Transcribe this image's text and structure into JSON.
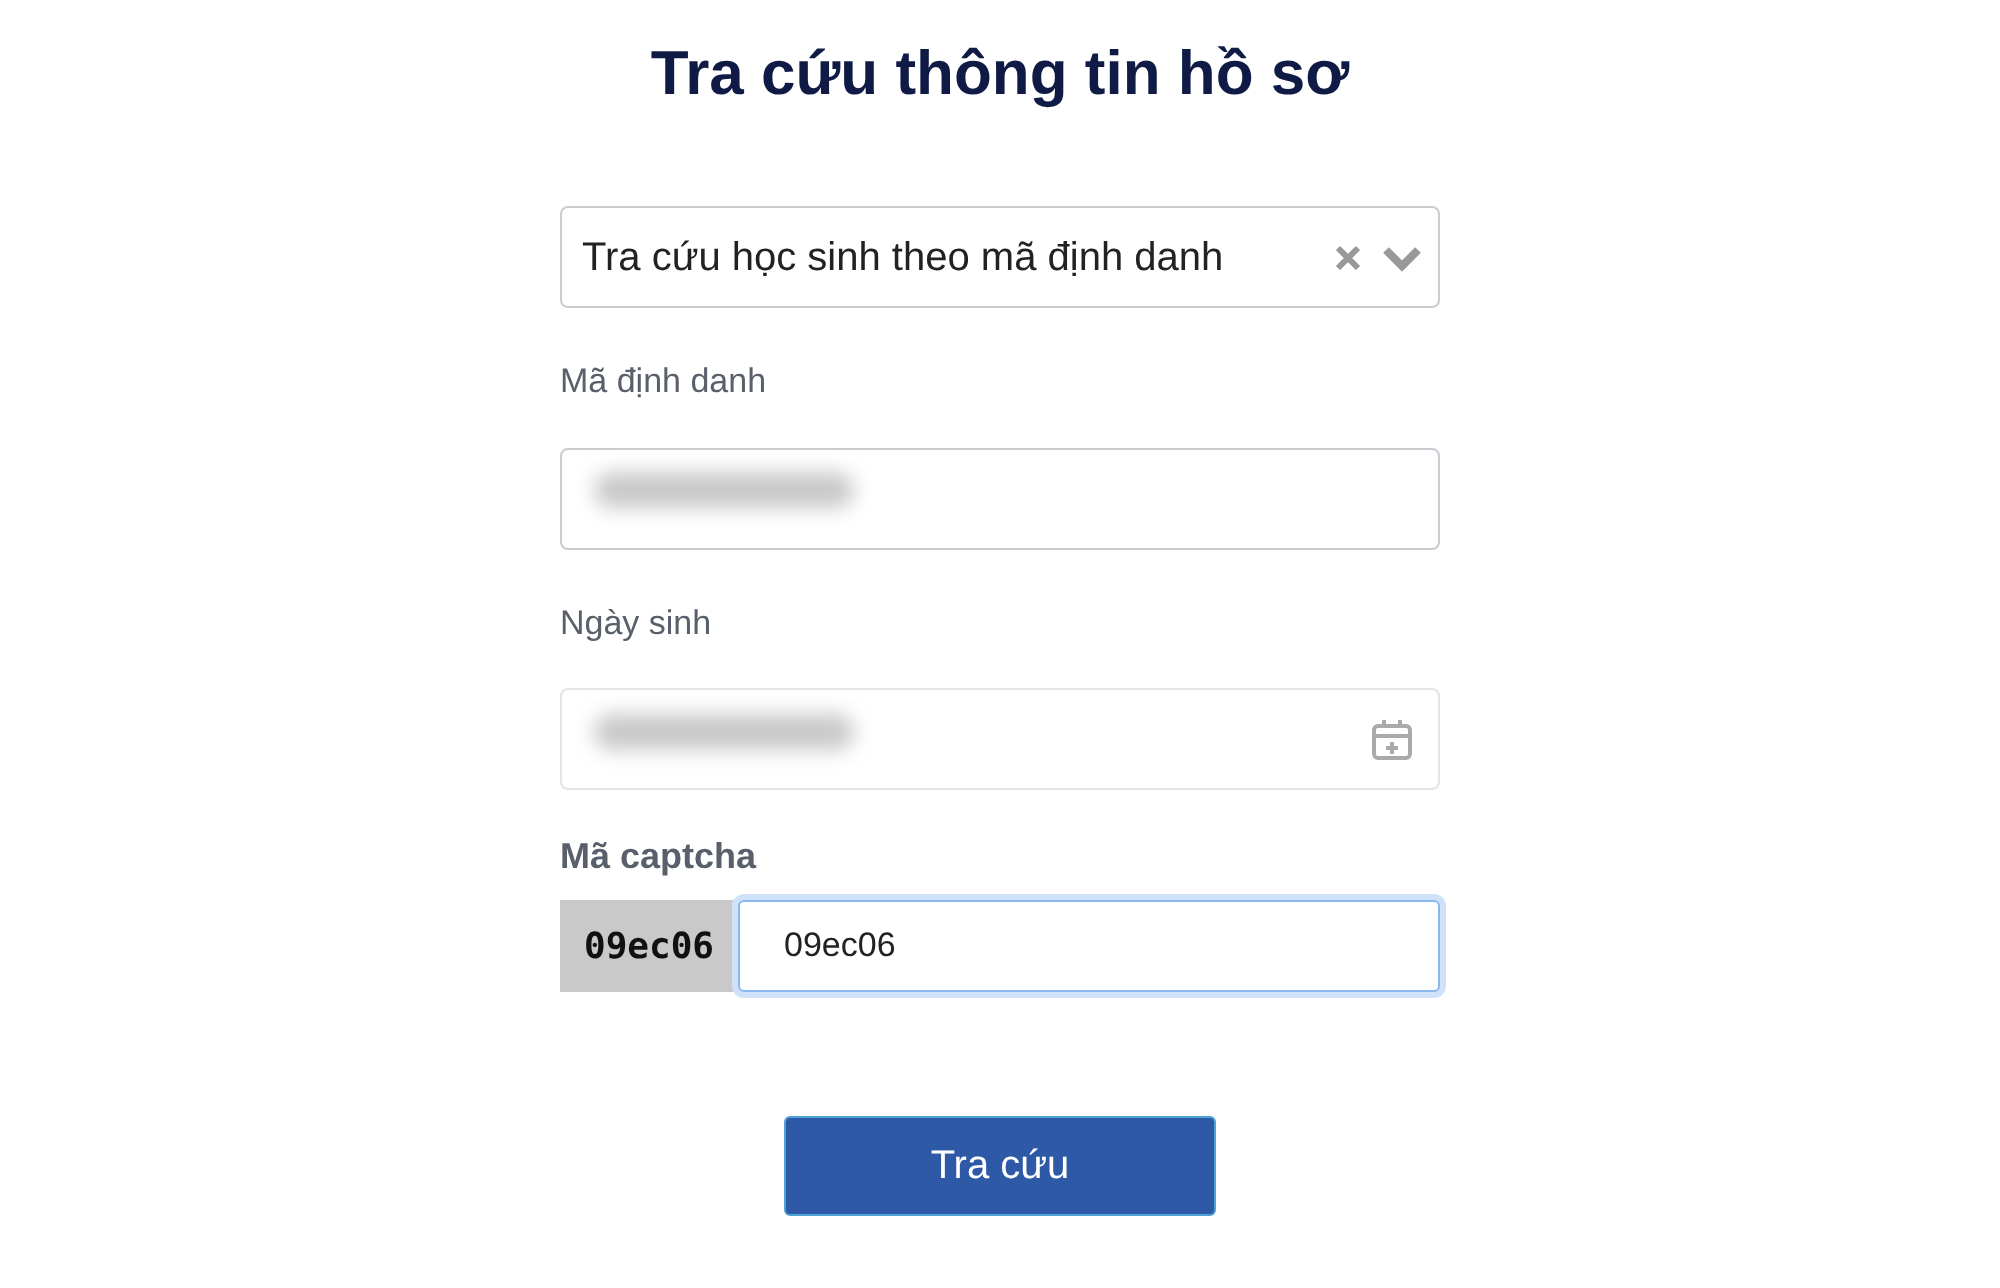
{
  "title": "Tra cứu thông tin hồ sơ",
  "lookup_type": {
    "value": "Tra cứu học sinh theo mã định danh",
    "clearable": true
  },
  "fields": [
    {
      "kind": "text",
      "label": "Mã định danh",
      "blurred": true
    },
    {
      "kind": "date",
      "label": "Ngày sinh",
      "blurred": true
    }
  ],
  "captcha": {
    "label": "Mã captcha",
    "code": "09ec06",
    "value": "09ec06",
    "focused": true
  },
  "submit_button": "Tra cứu"
}
